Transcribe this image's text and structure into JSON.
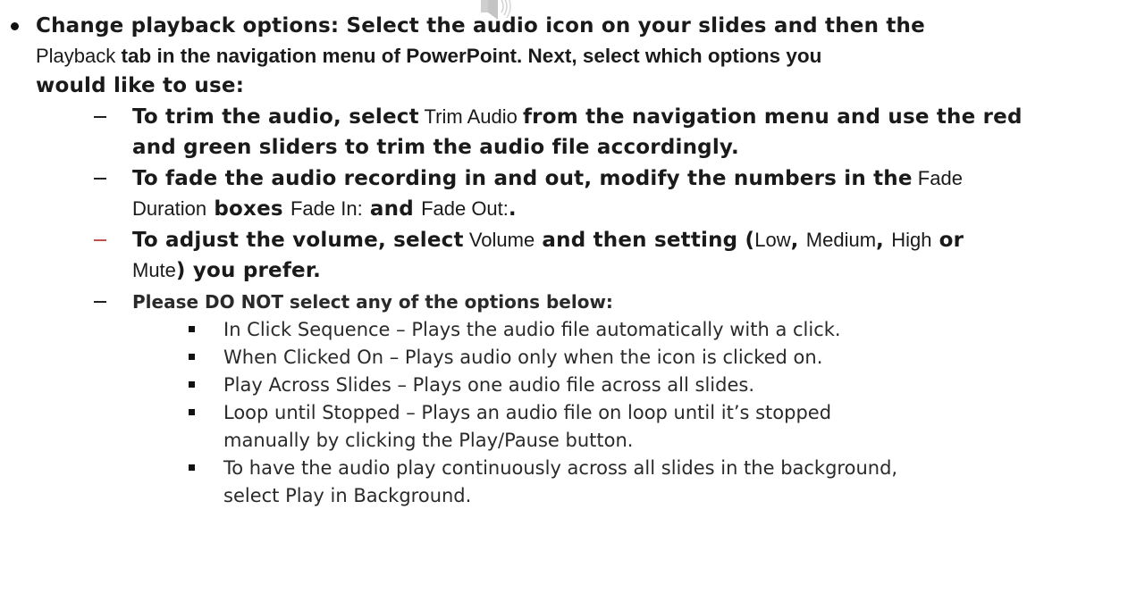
{
  "colors": {
    "text": "#1a1a1a",
    "dash_accent": "#c0504d",
    "icon": "#c8c8c8"
  },
  "icons": {
    "audio": "speaker-icon"
  },
  "main": {
    "l1": {
      "a": "Change playback options:",
      "b": " Select the audio icon on your slides and then the"
    },
    "l2": {
      "a": "Playback",
      "b": " tab in the navigation menu of PowerPoint. Next, select which options you"
    },
    "l3": "would like to use:",
    "trim": {
      "a": "To trim the audio, select",
      "b": " Trim Audio ",
      "c": "from the navigation menu and use the red",
      "d": "and green sliders to trim the audio file accordingly."
    },
    "fade": {
      "a": "To fade the audio recording in and out, modify the numbers in the",
      "b": " Fade",
      "c": "Duration",
      "d": " boxes ",
      "e": "Fade In:",
      "f": " and ",
      "g": "Fade Out:",
      "h": "."
    },
    "volume": {
      "a": "To adjust the volume, select",
      "b": " Volume",
      "c": " and then setting (",
      "d": "Low",
      "e": ", ",
      "f": "Medium",
      "g": ", ",
      "h": "High",
      "i": " or",
      "j": "Mute",
      "k": ") you prefer."
    },
    "dont": "Please DO NOT select any of the options below:",
    "options": [
      "In Click Sequence – Plays the audio file automatically with a click.",
      "When Clicked On – Plays audio only when the icon is clicked on.",
      "Play Across Slides – Plays one audio file across all slides.",
      "Loop until Stopped – Plays an audio file on loop until it’s stopped",
      "manually by clicking the Play/Pause button.",
      "To have the audio play continuously across all slides in the background,",
      "select Play in Background."
    ]
  }
}
